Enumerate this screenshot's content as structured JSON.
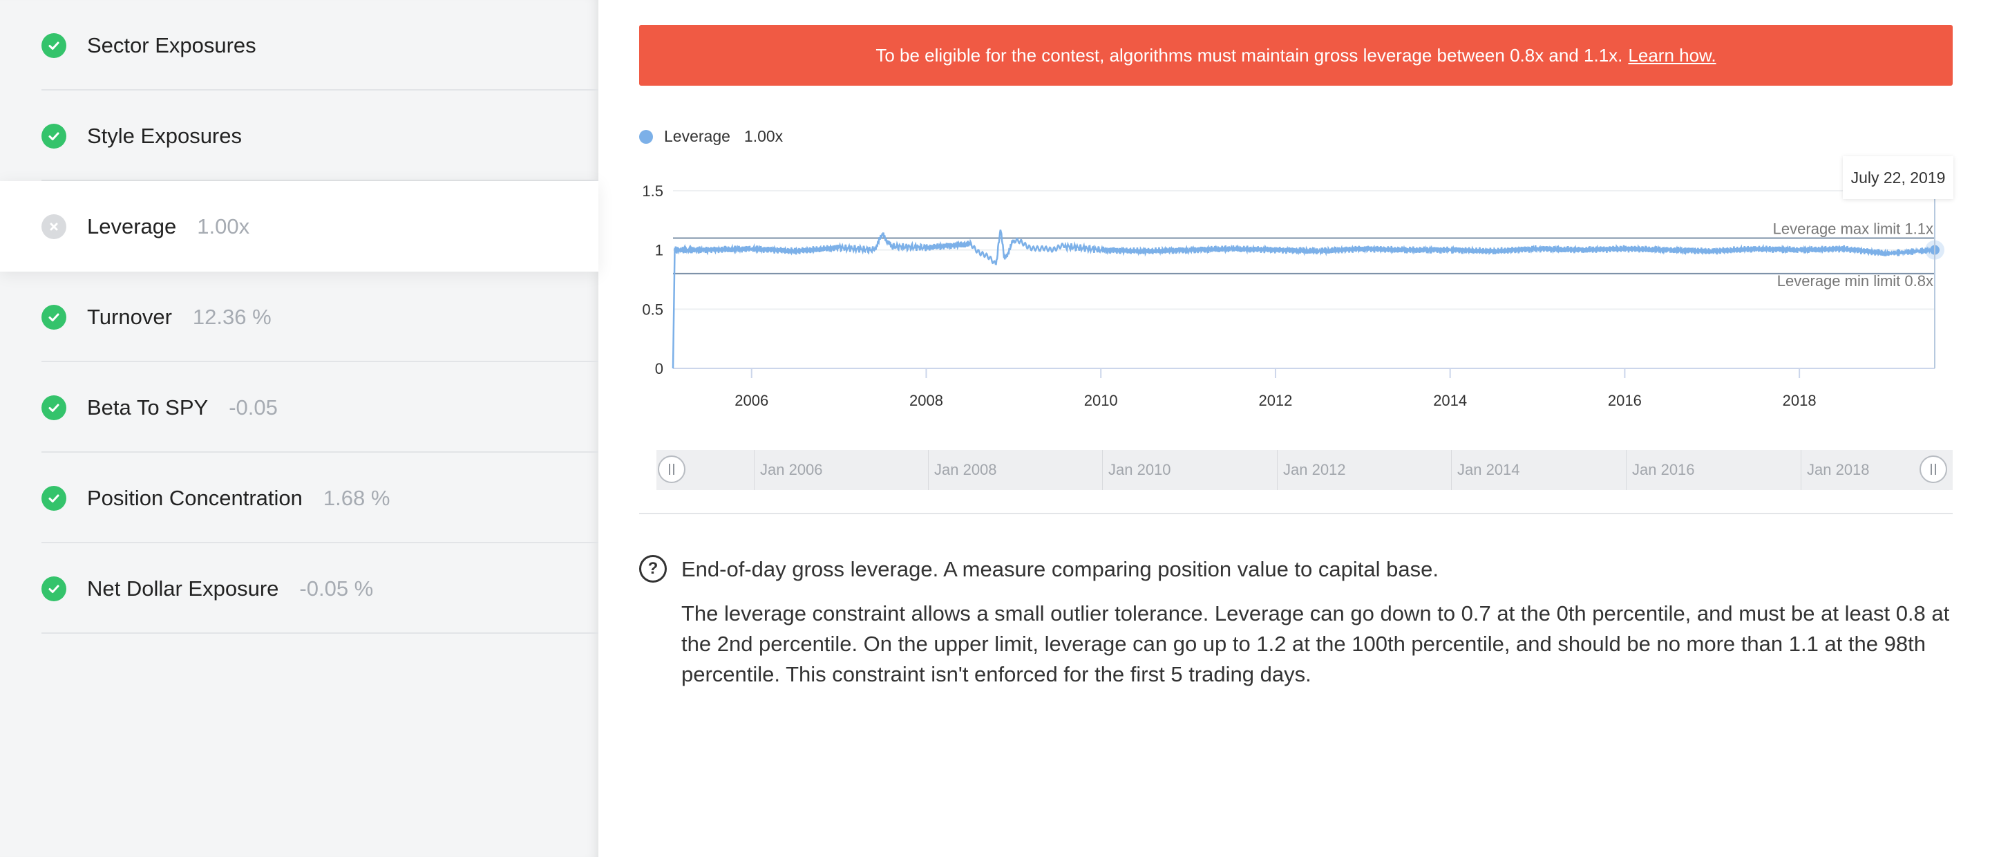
{
  "sidebar": {
    "items": [
      {
        "label": "Sector Exposures",
        "value": "",
        "status": "pass"
      },
      {
        "label": "Style Exposures",
        "value": "",
        "status": "pass"
      },
      {
        "label": "Leverage",
        "value": "1.00x",
        "status": "fail"
      },
      {
        "label": "Turnover",
        "value": "12.36 %",
        "status": "pass"
      },
      {
        "label": "Beta To SPY",
        "value": "-0.05",
        "status": "pass"
      },
      {
        "label": "Position Concentration",
        "value": "1.68 %",
        "status": "pass"
      },
      {
        "label": "Net Dollar Exposure",
        "value": "-0.05 %",
        "status": "pass"
      }
    ]
  },
  "banner": {
    "text": "To be eligible for the contest, algorithms must maintain gross leverage between 0.8x and 1.1x.",
    "link": "Learn how."
  },
  "legend": {
    "series_name": "Leverage",
    "current_value": "1.00x"
  },
  "tooltip": {
    "date": "July 22, 2019"
  },
  "chart_data": {
    "type": "line",
    "x_ticks": [
      "2006",
      "2008",
      "2010",
      "2012",
      "2014",
      "2016",
      "2018"
    ],
    "y_ticks": [
      "0",
      "0.5",
      "1",
      "1.5"
    ],
    "ylim": [
      0,
      1.5
    ],
    "xlim": [
      2005.1,
      2019.55
    ],
    "series": [
      {
        "name": "Leverage",
        "color": "#7cb0e8",
        "x": [
          2005.1,
          2005.12,
          2005.5,
          2006.0,
          2006.5,
          2007.0,
          2007.4,
          2007.5,
          2007.6,
          2008.0,
          2008.5,
          2008.8,
          2008.85,
          2008.9,
          2009.0,
          2009.3,
          2009.6,
          2010.0,
          2010.5,
          2011.0,
          2011.5,
          2012.0,
          2012.5,
          2013.0,
          2013.5,
          2014.0,
          2014.5,
          2015.0,
          2015.5,
          2016.0,
          2016.5,
          2017.0,
          2017.5,
          2018.0,
          2018.5,
          2019.0,
          2019.55
        ],
        "y": [
          0.0,
          1.0,
          1.0,
          1.01,
          0.99,
          1.02,
          1.0,
          1.13,
          1.03,
          1.02,
          1.05,
          0.88,
          1.17,
          0.92,
          1.08,
          1.0,
          1.03,
          1.0,
          0.99,
          1.0,
          1.01,
          1.0,
          0.99,
          1.01,
          1.0,
          1.0,
          0.99,
          1.01,
          1.0,
          1.01,
          1.0,
          0.99,
          1.01,
          1.0,
          1.01,
          0.97,
          1.0
        ]
      }
    ],
    "limits": [
      {
        "label": "Leverage max limit 1.1x",
        "value": 1.1
      },
      {
        "label": "Leverage min limit 0.8x",
        "value": 0.8
      }
    ]
  },
  "navigator": {
    "labels": [
      "Jan 2006",
      "Jan 2008",
      "Jan 2010",
      "Jan 2012",
      "Jan 2014",
      "Jan 2016",
      "Jan 2018"
    ]
  },
  "help": {
    "title": "End-of-day gross leverage. A measure comparing position value to capital base.",
    "body": "The leverage constraint allows a small outlier tolerance. Leverage can go down to 0.7 at the 0th percentile, and must be at least 0.8 at the 2nd percentile. On the upper limit, leverage can go up to 1.2 at the 100th percentile, and should be no more than 1.1 at the 98th percentile. This constraint isn't enforced for the first 5 trading days."
  }
}
